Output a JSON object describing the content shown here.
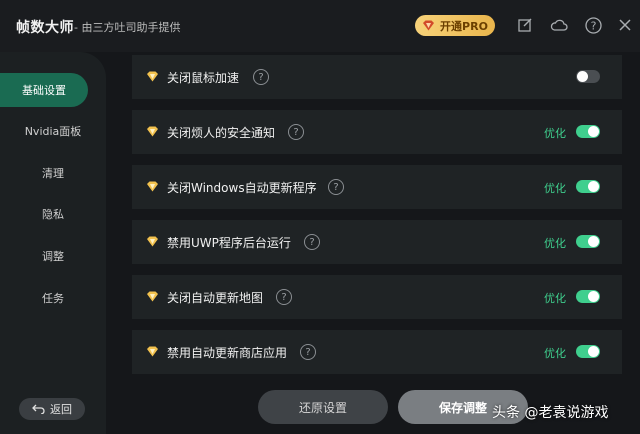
{
  "header": {
    "app_title": "帧数大师",
    "subtitle": "- 由三方吐司助手提供",
    "pro_label": "开通PRO",
    "icons": [
      "edit-icon",
      "cloud-icon",
      "help-icon",
      "close-icon"
    ]
  },
  "sidebar": {
    "items": [
      {
        "label": "基础设置",
        "active": true
      },
      {
        "label": "Nvidia面板",
        "active": false
      },
      {
        "label": "清理",
        "active": false
      },
      {
        "label": "隐私",
        "active": false
      },
      {
        "label": "调整",
        "active": false
      },
      {
        "label": "任务",
        "active": false
      }
    ],
    "back_label": "返回"
  },
  "settings": [
    {
      "label": "关闭鼠标加速",
      "status": "",
      "enabled": false
    },
    {
      "label": "关闭烦人的安全通知",
      "status": "优化",
      "enabled": true
    },
    {
      "label": "关闭Windows自动更新程序",
      "status": "优化",
      "enabled": true
    },
    {
      "label": "禁用UWP程序后台运行",
      "status": "优化",
      "enabled": true
    },
    {
      "label": "关闭自动更新地图",
      "status": "优化",
      "enabled": true
    },
    {
      "label": "禁用自动更新商店应用",
      "status": "优化",
      "enabled": true
    }
  ],
  "footer": {
    "restore_label": "还原设置",
    "save_label": "保存调整"
  },
  "watermark": "头条 @老袁说游戏",
  "colors": {
    "accent": "#3fcf8e",
    "active_nav": "#1a6b52",
    "pro_gold": "#f7d27a",
    "background": "#15171a"
  }
}
